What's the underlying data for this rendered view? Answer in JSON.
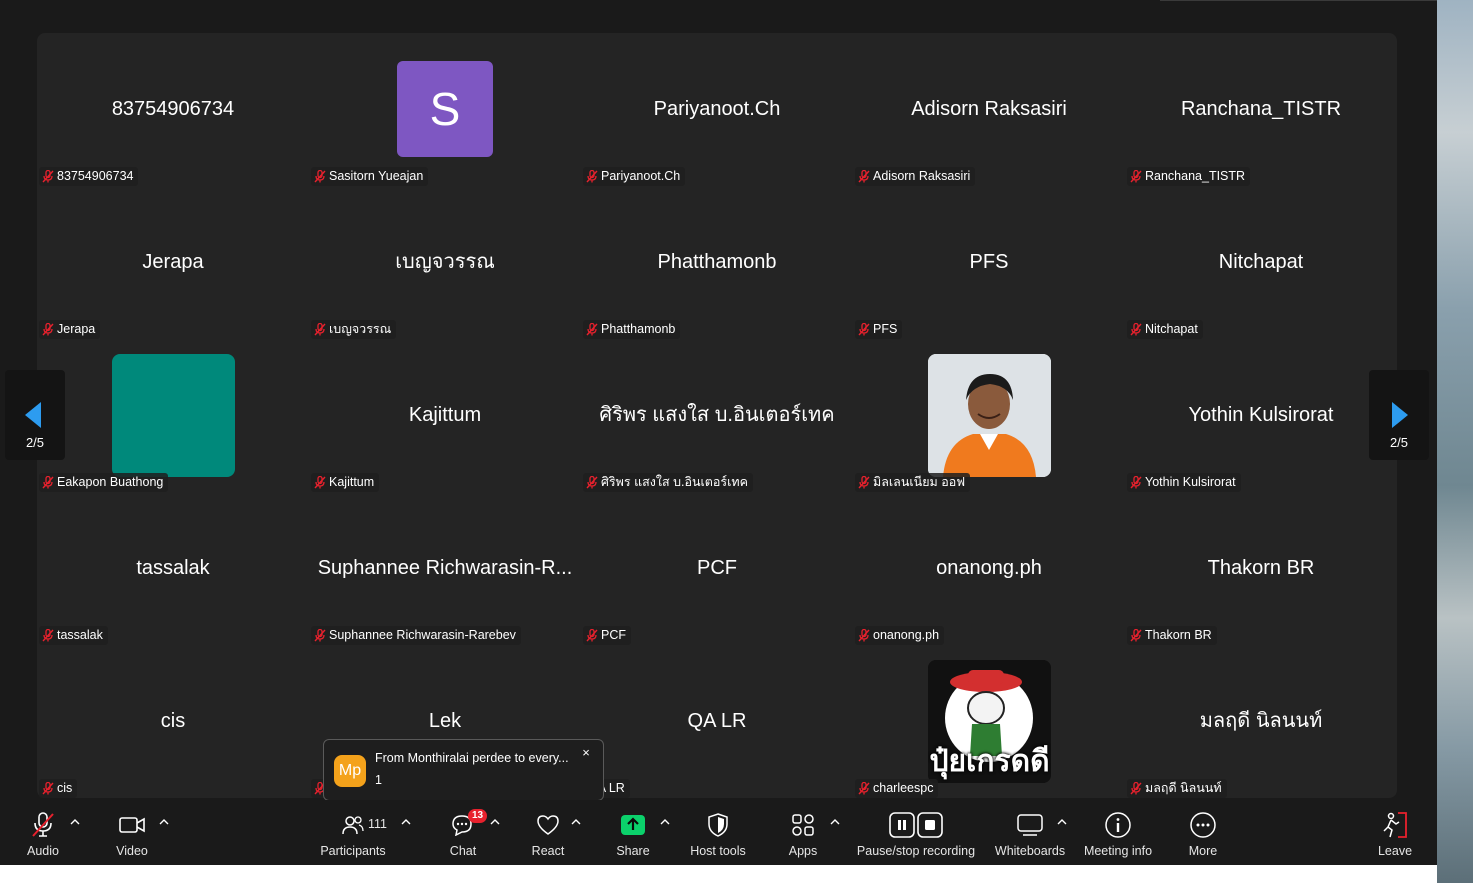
{
  "pager": {
    "left_count": "2/5",
    "right_count": "2/5"
  },
  "tiles": [
    {
      "name": "83754906734",
      "label": "83754906734"
    },
    {
      "name": "",
      "label": "Sasitorn Yueajan",
      "avatar_letter": "S"
    },
    {
      "name": "Pariyanoot.Ch",
      "label": "Pariyanoot.Ch"
    },
    {
      "name": "Adisorn Raksasiri",
      "label": "Adisorn Raksasiri"
    },
    {
      "name": "Ranchana_TISTR",
      "label": "Ranchana_TISTR"
    },
    {
      "name": "Jerapa",
      "label": "Jerapa"
    },
    {
      "name": "เบญจวรรณ",
      "label": "เบญจวรรณ"
    },
    {
      "name": "Phatthamonb",
      "label": "Phatthamonb"
    },
    {
      "name": "PFS",
      "label": "PFS"
    },
    {
      "name": "Nitchapat",
      "label": "Nitchapat"
    },
    {
      "name": "",
      "label": "Eakapon Buathong"
    },
    {
      "name": "Kajittum",
      "label": "Kajittum"
    },
    {
      "name": "ศิริพร  แสงใส  บ.อินเตอร์เทค",
      "label": "ศิริพร  แสงใส  บ.อินเตอร์เทค"
    },
    {
      "name": "",
      "label": "มิลเลนเนียม ออฟ"
    },
    {
      "name": "Yothin Kulsirorat",
      "label": "Yothin Kulsirorat"
    },
    {
      "name": "tassalak",
      "label": "tassalak"
    },
    {
      "name": "Suphannee Richwarasin-R...",
      "label": "Suphannee Richwarasin-Rarebev"
    },
    {
      "name": "PCF",
      "label": "PCF"
    },
    {
      "name": "onanong.ph",
      "label": "onanong.ph"
    },
    {
      "name": "Thakorn BR",
      "label": "Thakorn BR"
    },
    {
      "name": "cis",
      "label": "cis"
    },
    {
      "name": "Lek",
      "label": ""
    },
    {
      "name": "QA LR",
      "label": "QA LR"
    },
    {
      "name": "",
      "label": "charleespc",
      "logo_text": "ปุ๋ยเกรดดี"
    },
    {
      "name": "มลฤดี  นิลนนท์",
      "label": "มลฤดี  นิลนนท์"
    }
  ],
  "toast": {
    "avatar": "Mp",
    "title": "From Monthiralai perdee to every...",
    "body": "1",
    "close": "×"
  },
  "toolbar": {
    "audio": "Audio",
    "video": "Video",
    "participants": "Participants",
    "participants_count": "111",
    "chat": "Chat",
    "chat_badge": "13",
    "react": "React",
    "share": "Share",
    "host_tools": "Host tools",
    "apps": "Apps",
    "recording": "Pause/stop recording",
    "whiteboards": "Whiteboards",
    "meeting_info": "Meeting info",
    "more": "More",
    "leave": "Leave"
  },
  "colors": {
    "share_green": "#0bd16b",
    "badge_red": "#e8212d",
    "avatar_purple": "#7e57c2",
    "teal": "#00897b",
    "toast_avatar": "#f4a21b"
  }
}
